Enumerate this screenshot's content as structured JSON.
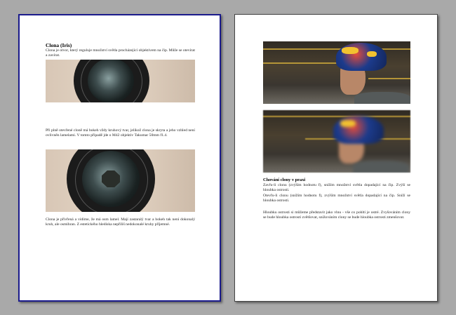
{
  "left_page": {
    "heading": "Clona (Iris)",
    "intro": "Clona je otvor, který reguluje množství světla procházející objektivem na čip. Může se otevírat a zavírat.",
    "para_open": "Při plně otevřené cloně má bokeh vždy kruhový tvar, jelikož clona je skryta a jeho vzhled není ovlivněn lamelami. V tomto případě jde o M42 objektiv Takumar 50mm f1.4.",
    "para_closed": "Clona je přivřená a vidíme, že má osm lamel. Mají zastaralý tvar a bokeh tak není dokonalý kruh, ale osmihran. Z estetického hlediska nepříliš nedokonalé kruhy příjemné."
  },
  "right_page": {
    "heading": "Chování clony v praxi",
    "para_1": "Zavřu-li clonu (zvýším hodnotu f), snížím množství světla dopadající na čip. Zvýší se hloubka ostrosti.",
    "para_2": "Otevřu-li clonu (snížím hodnotu f), zvýším množství světla dopadající na čip. Sníží se hloubka ostrosti.",
    "para_3": "Hloubku ostrosti si můžeme představit jako vlnu - vše co pohltí je ostré. Zvyšováním clony se bude hloubka ostrosti zvětšovat, snižováním clony se bude hloubka ostrosti zmenšovat."
  },
  "colors": {
    "background": "#a9a9a9",
    "selected_page_border": "#1a1a8c",
    "helmet_red": "#e64b3a",
    "helmet_blue": "#1c3b8c",
    "helmet_yellow": "#f2c230"
  }
}
